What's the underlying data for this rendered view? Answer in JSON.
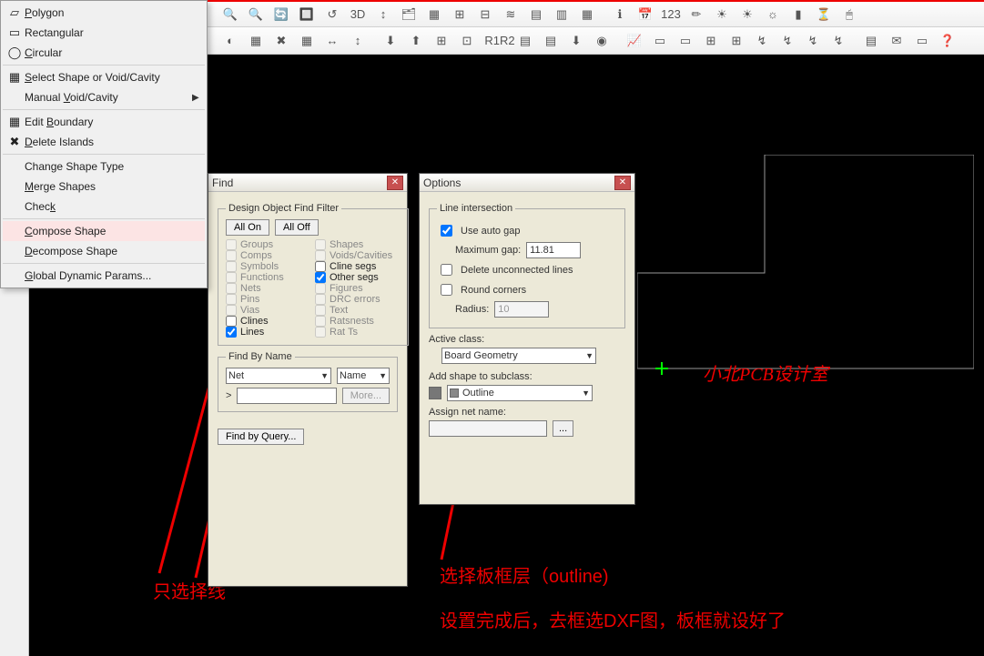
{
  "toolbar": {
    "row1": [
      "🔍",
      "🔍",
      "🔄",
      "🔲",
      "↺",
      "3D",
      "↕",
      "🗂",
      "▦",
      "⊞",
      "⊟",
      "≋",
      "▤",
      "▥",
      "▦",
      "|",
      "ℹ",
      "📅",
      "123",
      "✏",
      "☀",
      "☀",
      "☼",
      "▮",
      "⏳",
      "🖱"
    ],
    "row2": [
      "◐",
      "▦",
      "✖",
      "▦",
      "↔",
      "↕",
      "|",
      "⬇",
      "⬆",
      "⊞",
      "⊡",
      "|",
      "R1R2",
      "▤",
      "▤",
      "⬇",
      "◉",
      "|",
      "📈",
      "▭",
      "▭",
      "⊞",
      "⊞",
      "↯",
      "↯",
      "↯",
      "↯",
      "|",
      "▤",
      "✉",
      "▭",
      "❓"
    ]
  },
  "menu": {
    "sections": [
      [
        {
          "icon": "▱",
          "label": "Polygon",
          "u": "P"
        },
        {
          "icon": "▭",
          "label": "Rectangular",
          "u": ""
        },
        {
          "icon": "◯",
          "label": "Circular",
          "u": "C"
        }
      ],
      [
        {
          "icon": "▦",
          "label": "Select Shape or Void/Cavity",
          "u": "S"
        },
        {
          "icon": "",
          "label": "Manual Void/Cavity",
          "u": "V",
          "arrow": true
        }
      ],
      [
        {
          "icon": "▦",
          "label": "Edit Boundary",
          "u": "B"
        },
        {
          "icon": "✖",
          "label": "Delete Islands",
          "u": "D"
        }
      ],
      [
        {
          "icon": "",
          "label": "Change Shape Type",
          "u": ""
        },
        {
          "icon": "",
          "label": "Merge Shapes",
          "u": "M"
        },
        {
          "icon": "",
          "label": "Check",
          "u": "k"
        }
      ],
      [
        {
          "icon": "",
          "label": "Compose Shape",
          "u": "C",
          "highlight": true
        },
        {
          "icon": "",
          "label": "Decompose Shape",
          "u": "D"
        }
      ],
      [
        {
          "icon": "",
          "label": "Global Dynamic Params...",
          "u": "G"
        }
      ]
    ]
  },
  "find": {
    "title": "Find",
    "filter_legend": "Design Object Find Filter",
    "all_on": "All On",
    "all_off": "All Off",
    "cols": [
      [
        {
          "label": "Groups",
          "checked": false,
          "enabled": false
        },
        {
          "label": "Comps",
          "checked": false,
          "enabled": false
        },
        {
          "label": "Symbols",
          "checked": false,
          "enabled": false
        },
        {
          "label": "Functions",
          "checked": false,
          "enabled": false
        },
        {
          "label": "Nets",
          "checked": false,
          "enabled": false
        },
        {
          "label": "Pins",
          "checked": false,
          "enabled": false
        },
        {
          "label": "Vias",
          "checked": false,
          "enabled": false
        },
        {
          "label": "Clines",
          "checked": false,
          "enabled": true
        },
        {
          "label": "Lines",
          "checked": true,
          "enabled": true
        }
      ],
      [
        {
          "label": "Shapes",
          "checked": false,
          "enabled": false
        },
        {
          "label": "Voids/Cavities",
          "checked": false,
          "enabled": false
        },
        {
          "label": "Cline segs",
          "checked": false,
          "enabled": true
        },
        {
          "label": "Other segs",
          "checked": true,
          "enabled": true
        },
        {
          "label": "Figures",
          "checked": false,
          "enabled": false
        },
        {
          "label": "DRC errors",
          "checked": false,
          "enabled": false
        },
        {
          "label": "Text",
          "checked": false,
          "enabled": false
        },
        {
          "label": "Ratsnests",
          "checked": false,
          "enabled": false
        },
        {
          "label": "Rat Ts",
          "checked": false,
          "enabled": false
        }
      ]
    ],
    "find_by_name": "Find By Name",
    "name_type": "Net",
    "name_mode": "Name",
    "prompt": ">",
    "more": "More...",
    "find_by_query": "Find by Query..."
  },
  "options": {
    "title": "Options",
    "line_intersection": "Line intersection",
    "use_auto_gap": "Use auto gap",
    "use_auto_gap_checked": true,
    "max_gap_label": "Maximum gap:",
    "max_gap_value": "11.81",
    "delete_unconnected": "Delete unconnected lines",
    "delete_unconnected_checked": false,
    "round_corners": "Round corners",
    "round_corners_checked": false,
    "radius_label": "Radius:",
    "radius_value": "10",
    "active_class_label": "Active class:",
    "active_class_value": "Board Geometry",
    "add_shape_label": "Add shape to subclass:",
    "subclass_value": "Outline",
    "assign_net_label": "Assign net name:",
    "assign_net_value": "",
    "browse": "..."
  },
  "annotations": {
    "watermark": "小北PCB设计室",
    "anno1": "只选择线",
    "anno2": "选择板框层（outline)",
    "anno3": "设置完成后，去框选DXF图，板框就设好了"
  }
}
